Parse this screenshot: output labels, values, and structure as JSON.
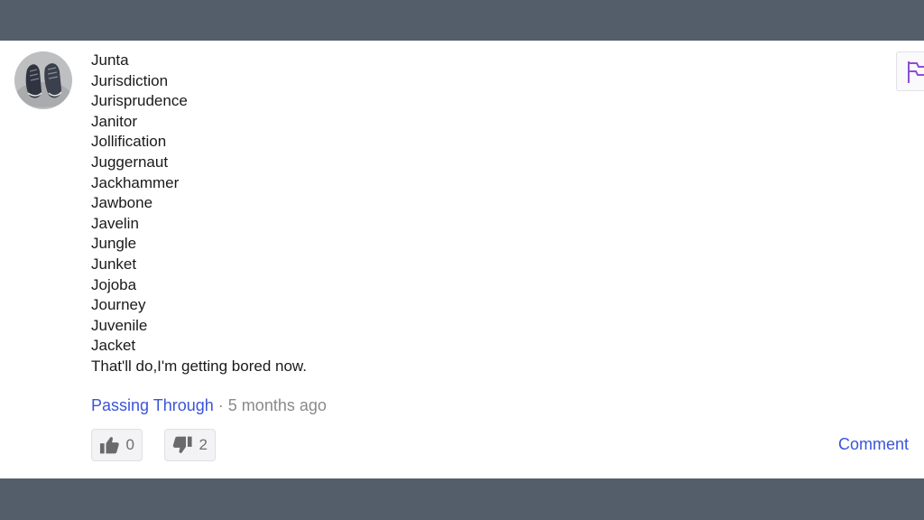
{
  "comment": {
    "lines": [
      "Junta",
      "Jurisdiction",
      "Jurisprudence",
      "Janitor",
      "Jollification",
      "Juggernaut",
      "Jackhammer",
      "Jawbone",
      "Javelin",
      "Jungle",
      "Junket",
      "Jojoba",
      "Journey",
      "Juvenile",
      "Jacket",
      "That'll do,I'm getting bored now."
    ],
    "author": "Passing Through",
    "separator": "·",
    "age": "5 months ago",
    "upvotes": "0",
    "downvotes": "2",
    "comment_label": "Comment"
  },
  "icons": {
    "avatar": "shoes-photo",
    "flag": "flag-icon",
    "upvote": "thumbs-up-icon",
    "downvote": "thumbs-down-icon"
  },
  "colors": {
    "link": "#3b55d8",
    "flag": "#8a4fd8",
    "frame": "#545e6b"
  }
}
